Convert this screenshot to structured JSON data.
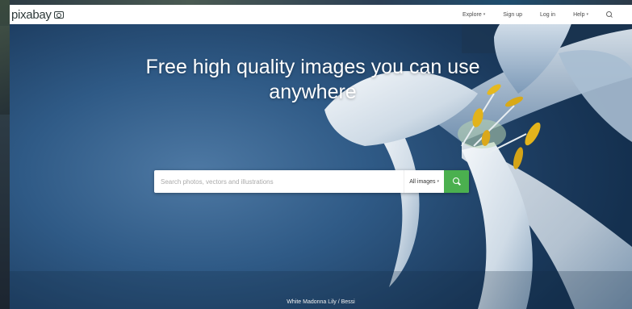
{
  "header": {
    "logo_text": "pixabay",
    "nav": {
      "explore": "Explore",
      "signup": "Sign up",
      "login": "Log in",
      "help": "Help"
    }
  },
  "hero": {
    "headline": "Free high quality images you can use anywhere",
    "search": {
      "placeholder": "Search photos, vectors and illustrations",
      "value": "",
      "filter_label": "All images"
    },
    "photo_caption": "White Madonna Lily / Bessi"
  },
  "colors": {
    "search_button": "#4bb04f",
    "hero_sky": "#2f5a86",
    "topbar": "#ffffff"
  },
  "icons": {
    "logo": "camera-icon",
    "nav_search": "search-icon",
    "search_button": "search-icon"
  }
}
